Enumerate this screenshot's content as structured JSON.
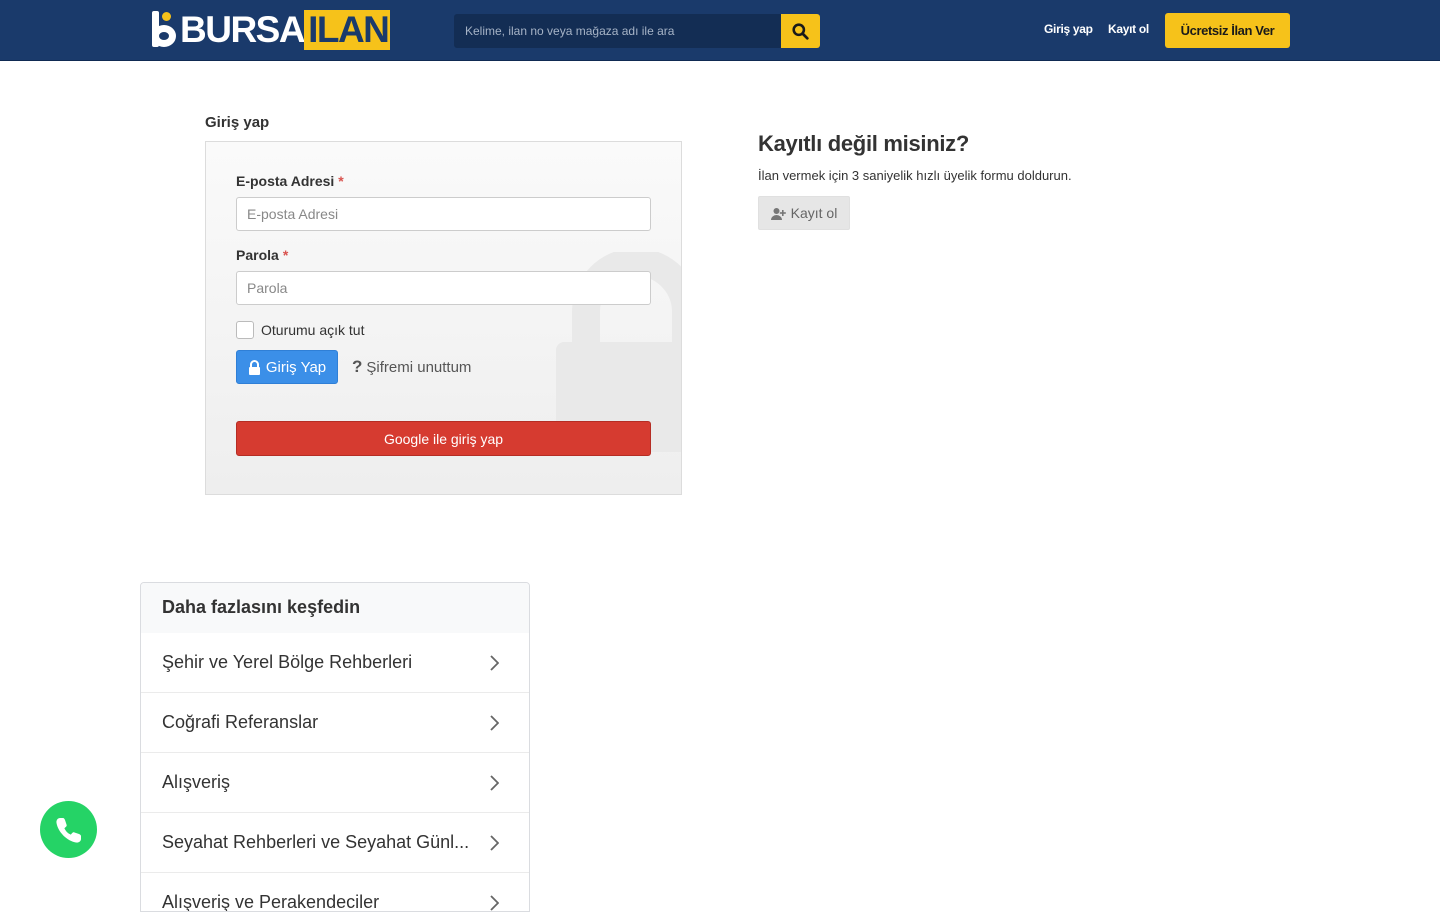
{
  "header": {
    "logo_part1": "BURSA",
    "logo_part2": "ILAN",
    "search_placeholder": "Kelime, ilan no veya mağaza adı ile ara",
    "nav_login": "Giriş yap",
    "nav_register": "Kayıt ol",
    "post_ad_button": "Ücretsiz İlan Ver",
    "colors": {
      "bar": "#1a3a6b",
      "accent": "#f6c21a"
    }
  },
  "login": {
    "title": "Giriş yap",
    "email_label": "E-posta Adresi",
    "email_placeholder": "E-posta Adresi",
    "email_value": "",
    "password_label": "Parola",
    "password_placeholder": "Parola",
    "password_value": "",
    "required_mark": "*",
    "remember_label": "Oturumu açık tut",
    "remember_checked": false,
    "login_button": "Giriş Yap",
    "forgot_link": "Şifremi unuttum",
    "forgot_icon": "?",
    "google_button": "Google ile giriş yap",
    "colors": {
      "primary": "#3b8fe8",
      "google": "#d63b30"
    }
  },
  "register": {
    "title": "Kayıtlı değil misiniz?",
    "description": "İlan vermek için 3 saniyelik hızlı üyelik formu doldurun.",
    "button": "Kayıt ol"
  },
  "explore": {
    "title": "Daha fazlasını keşfedin",
    "items": [
      {
        "label": "Şehir ve Yerel Bölge Rehberleri"
      },
      {
        "label": "Coğrafi Referanslar"
      },
      {
        "label": "Alışveriş"
      },
      {
        "label": "Seyahat Rehberleri ve Seyahat Günl..."
      },
      {
        "label": "Alışveriş ve Perakendeciler"
      }
    ]
  },
  "whatsapp": {
    "icon": "whatsapp-phone-icon",
    "color": "#25d366"
  }
}
